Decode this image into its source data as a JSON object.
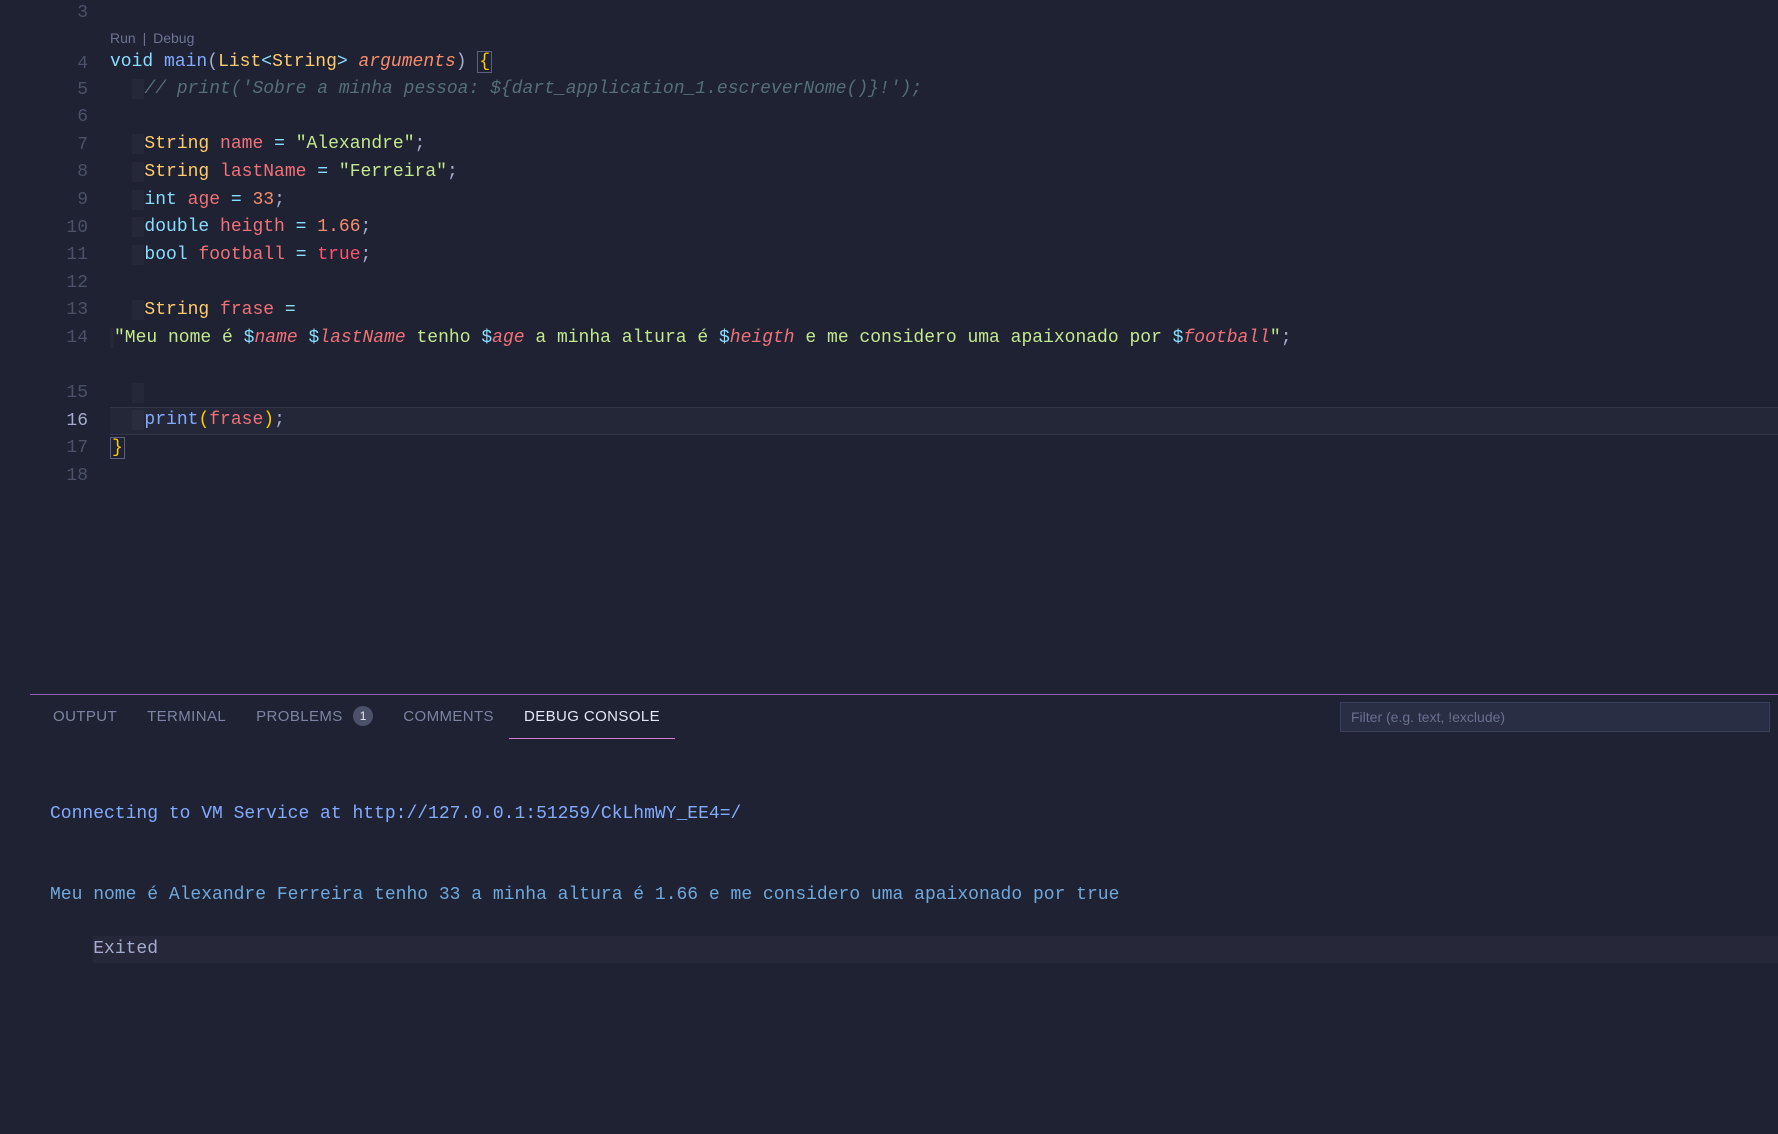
{
  "codelens": {
    "run": "Run",
    "debug": "Debug",
    "sep": "|"
  },
  "gutter": {
    "start": 3,
    "end": 18,
    "active": 16
  },
  "code": {
    "l4": {
      "void": "void",
      "main": "main",
      "lp": "(",
      "list": "List",
      "lt": "<",
      "string": "String",
      "gt": ">",
      "sp": " ",
      "arguments": "arguments",
      "rp": ")",
      "sp2": " ",
      "ob": "{"
    },
    "l5": {
      "comment": "// print('Sobre a minha pessoa: ${dart_application_1.escreverNome()}!');"
    },
    "l7": {
      "type": "String",
      "name": "name",
      "eq": "=",
      "val": "\"Alexandre\"",
      "sc": ";"
    },
    "l8": {
      "type": "String",
      "name": "lastName",
      "eq": "=",
      "val": "\"Ferreira\"",
      "sc": ";"
    },
    "l9": {
      "type": "int",
      "name": "age",
      "eq": "=",
      "val": "33",
      "sc": ";"
    },
    "l10": {
      "type": "double",
      "name": "heigth",
      "eq": "=",
      "val": "1.66",
      "sc": ";"
    },
    "l11": {
      "type": "bool",
      "name": "football",
      "eq": "=",
      "val": "true",
      "sc": ";"
    },
    "l13": {
      "type": "String",
      "name": "frase",
      "eq": "="
    },
    "l14": {
      "q1": "\"Meu nome é ",
      "d1": "$",
      "v1": "name",
      "s1": " ",
      "d2": "$",
      "v2": "lastName",
      "s2": " tenho ",
      "d3": "$",
      "v3": "age",
      "s3": " a minha altura é ",
      "d4": "$",
      "v4": "heigth",
      "s4": " e me considero uma apaixonado por ",
      "d5": "$",
      "v5": "football",
      "q2": "\"",
      "sc": ";"
    },
    "l16": {
      "fn": "print",
      "lp": "(",
      "arg": "frase",
      "rp": ")",
      "sc": ";"
    },
    "l17": {
      "cb": "}"
    }
  },
  "panel": {
    "tabs": {
      "output": "OUTPUT",
      "terminal": "TERMINAL",
      "problems": "PROBLEMS",
      "problems_badge": "1",
      "comments": "COMMENTS",
      "debug_console": "DEBUG CONSOLE"
    },
    "filter_placeholder": "Filter (e.g. text, !exclude)",
    "console": {
      "l1": "Connecting to VM Service at http://127.0.0.1:51259/CkLhmWY_EE4=/",
      "l2": "Meu nome é Alexandre Ferreira tenho 33 a minha altura é 1.66 e me considero uma apaixonado por true",
      "l3": "Exited"
    }
  }
}
